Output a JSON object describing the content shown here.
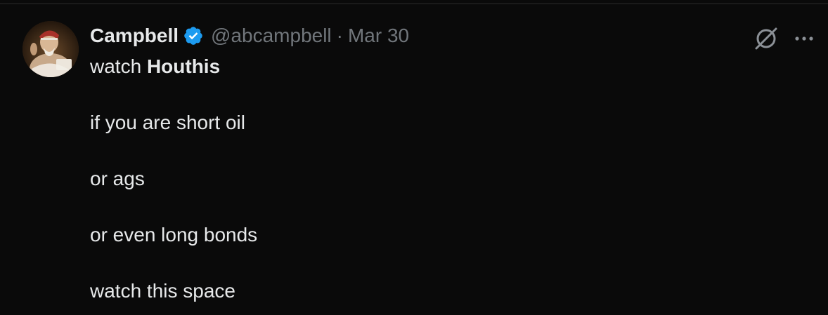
{
  "tweet": {
    "author": {
      "display_name": "Campbell",
      "handle": "@abcampbell",
      "verified": true,
      "verified_badge_color": "#1d9bf0"
    },
    "separator": "·",
    "date": "Mar 30",
    "body": {
      "line1_prefix": "watch",
      "line1_bold": "Houthis",
      "line2": "if you are short oil",
      "line3": "or ags",
      "line4": "or even long bonds",
      "line5": "watch this space"
    },
    "icons": {
      "grok": "grok-icon",
      "more": "more-icon",
      "verified": "verified-badge-icon"
    }
  },
  "colors": {
    "background": "#0a0a0a",
    "text_primary": "#e7e9ea",
    "text_secondary": "#71767b"
  }
}
